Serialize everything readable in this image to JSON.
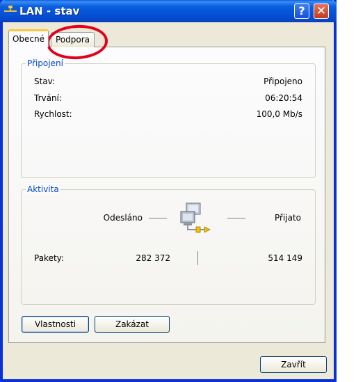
{
  "window": {
    "title": "LAN - stav",
    "help_label": "?",
    "close_label": "✕"
  },
  "tabs": [
    {
      "label": "Obecné"
    },
    {
      "label": "Podpora"
    }
  ],
  "connection": {
    "title": "Připojení",
    "rows": [
      {
        "label": "Stav:",
        "value": "Připojeno"
      },
      {
        "label": "Trvání:",
        "value": "06:20:54"
      },
      {
        "label": "Rychlost:",
        "value": "100,0 Mb/s"
      }
    ]
  },
  "activity": {
    "title": "Aktivita",
    "sent_label": "Odesláno",
    "received_label": "Přijato",
    "packets_label": "Pakety:",
    "packets_sent": "282 372",
    "packets_received": "514 149"
  },
  "buttons": {
    "properties": "Vlastnosti",
    "disable": "Zakázat",
    "close": "Zavřít"
  },
  "colors": {
    "titlebar": "#0a5fe0",
    "group_title": "#0046d5",
    "annotation": "#e3001b"
  }
}
